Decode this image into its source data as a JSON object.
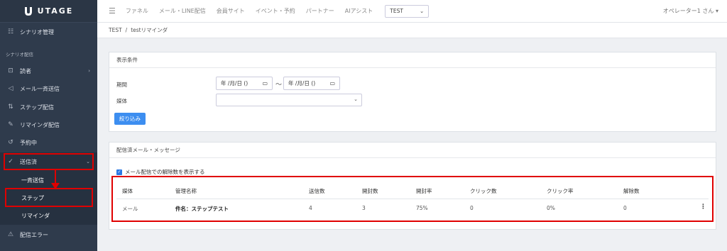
{
  "brand": {
    "name": "UTAGE"
  },
  "sidebar": {
    "top_item": {
      "icon": "list-icon",
      "label": "シナリオ管理"
    },
    "section_label": "シナリオ配信",
    "items": [
      {
        "icon": "book-icon",
        "label": "読者",
        "has_chevron": true
      },
      {
        "icon": "send-icon",
        "label": "メール一斉送信"
      },
      {
        "icon": "sort-icon",
        "label": "ステップ配信"
      },
      {
        "icon": "pencil-icon",
        "label": "リマインダ配信"
      },
      {
        "icon": "history-icon",
        "label": "予約中"
      },
      {
        "icon": "check-icon",
        "label": "送信済",
        "has_chevron": true,
        "active": true
      }
    ],
    "sub_items": [
      "一斉送信",
      "ステップ",
      "リマインダ"
    ],
    "bottom_item": {
      "icon": "warning-icon",
      "label": "配信エラー"
    }
  },
  "header": {
    "menu_icon": "hamburger-icon",
    "nav": [
      "ファネル",
      "メール・LINE配信",
      "会員サイト",
      "イベント・予約",
      "パートナー",
      "AIアシスト"
    ],
    "account_select": "TEST",
    "user_menu": "オペレーター1 さん"
  },
  "breadcrumb": {
    "parent": "TEST",
    "separator": "/",
    "current": "testリマインダ"
  },
  "filter": {
    "title": "表示条件",
    "period_label": "期間",
    "date_from_placeholder": "年 /月/日 ()",
    "tilde": "〜",
    "date_to_placeholder": "年 /月/日 ()",
    "media_label": "媒体",
    "media_value": "",
    "submit_label": "絞り込み"
  },
  "results": {
    "title": "配信済メール・メッセージ",
    "show_unsubscribe_label": "メール配信での解除数を表示する",
    "show_unsubscribe_checked": true,
    "columns": [
      "媒体",
      "管理名称",
      "送信数",
      "開封数",
      "開封率",
      "クリック数",
      "クリック率",
      "解除数"
    ],
    "rows": [
      {
        "media": "メール",
        "name": "件名：ステップテスト",
        "sent": "4",
        "opened": "3",
        "open_rate": "75%",
        "clicks": "0",
        "click_rate": "0%",
        "unsubscribed": "0"
      }
    ]
  },
  "colors": {
    "sidebar_bg": "#2f3b4c",
    "accent": "#3d8ef0",
    "highlight": "#e00000"
  }
}
